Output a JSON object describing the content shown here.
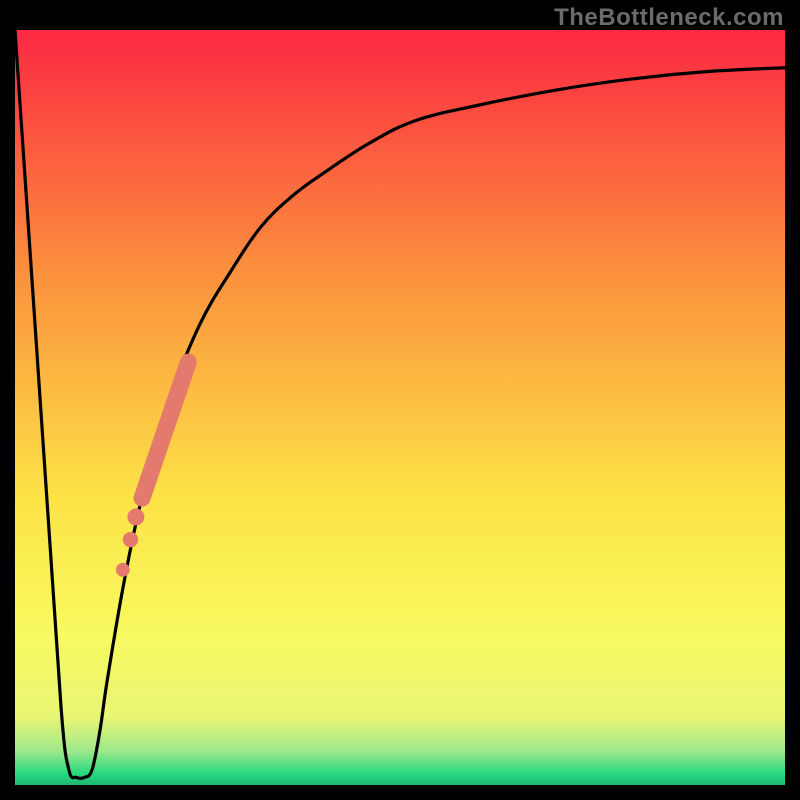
{
  "watermark": "TheBottleneck.com",
  "colors": {
    "gradient_top": "#fb2842",
    "gradient_upper_mid": "#fb903d",
    "gradient_mid": "#fce346",
    "gradient_lower_mid": "#f8fa60",
    "gradient_near_bottom": "#c4f178",
    "gradient_bottom": "#27d980",
    "curve": "#000000",
    "dots": "#e47a6e",
    "frame": "#000000",
    "watermark": "#6b6b6b"
  },
  "chart_data": {
    "type": "line",
    "title": "",
    "xlabel": "",
    "ylabel": "",
    "xlim": [
      0,
      100
    ],
    "ylim": [
      0,
      100
    ],
    "series": [
      {
        "name": "bottleneck-curve",
        "x": [
          0,
          4,
          6,
          7,
          8,
          9,
          10,
          11,
          12,
          14,
          16,
          18,
          20,
          24,
          28,
          32,
          36,
          40,
          46,
          52,
          60,
          70,
          80,
          90,
          100
        ],
        "y": [
          100,
          40,
          10,
          2,
          1,
          1,
          2,
          7,
          14,
          26,
          36,
          44,
          51,
          61,
          68,
          74,
          78,
          81,
          85,
          88,
          90,
          92,
          93.5,
          94.5,
          95
        ]
      }
    ],
    "thick_segment": {
      "name": "highlight-band",
      "x": [
        16.5,
        22.5
      ],
      "y": [
        38,
        56
      ]
    },
    "dots": [
      {
        "x": 15.7,
        "y": 35.5
      },
      {
        "x": 15.0,
        "y": 32.5
      },
      {
        "x": 14.0,
        "y": 28.5
      }
    ],
    "gradient_stops": [
      {
        "offset": 0.0,
        "color": "#fb2842"
      },
      {
        "offset": 0.32,
        "color": "#fb903d"
      },
      {
        "offset": 0.62,
        "color": "#fce346"
      },
      {
        "offset": 0.8,
        "color": "#f8fa60"
      },
      {
        "offset": 0.91,
        "color": "#e8f574"
      },
      {
        "offset": 0.955,
        "color": "#9ee88a"
      },
      {
        "offset": 0.985,
        "color": "#27d980"
      },
      {
        "offset": 1.0,
        "color": "#1fb873"
      }
    ]
  }
}
